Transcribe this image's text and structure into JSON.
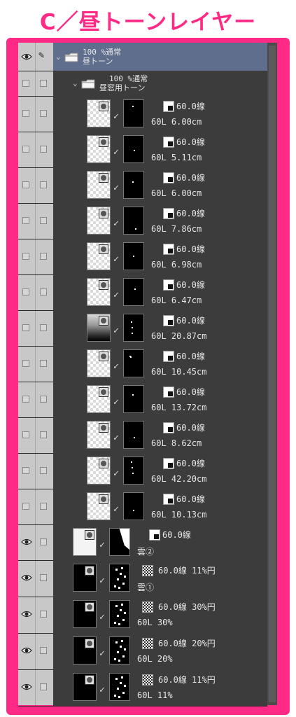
{
  "title": "C／昼トーンレイヤー",
  "groups": [
    {
      "line1": "100 %通常",
      "line2": "昼トーン"
    },
    {
      "line1": "100 %通常",
      "line2": "昼窓用トーン"
    }
  ],
  "tone_layers": [
    {
      "density": "60.0線",
      "name": "60L 6.00cm"
    },
    {
      "density": "60.0線",
      "name": "60L 5.11cm"
    },
    {
      "density": "60.0線",
      "name": "60L 6.00cm"
    },
    {
      "density": "60.0線",
      "name": "60L 7.86cm"
    },
    {
      "density": "60.0線",
      "name": "60L 6.98cm"
    },
    {
      "density": "60.0線",
      "name": "60L 6.47cm"
    },
    {
      "density": "60.0線",
      "name": "60L 20.87cm"
    },
    {
      "density": "60.0線",
      "name": "60L 10.45cm"
    },
    {
      "density": "60.0線",
      "name": "60L 13.72cm"
    },
    {
      "density": "60.0線",
      "name": "60L 8.62cm"
    },
    {
      "density": "60.0線",
      "name": "60L 42.20cm"
    },
    {
      "density": "60.0線",
      "name": "60L 10.13cm"
    }
  ],
  "outer_layers": [
    {
      "density": "60.0線",
      "name": "雲②"
    },
    {
      "density": "60.0線 11%円",
      "name": "雲①"
    },
    {
      "density": "60.0線 30%円",
      "name": "60L 30%"
    },
    {
      "density": "60.0線 20%円",
      "name": "60L 20%"
    },
    {
      "density": "60.0線 11%円",
      "name": "60L 11%"
    }
  ],
  "colors": {
    "accent": "#ff2a86",
    "selected": "#5e6e8c",
    "panel": "#3a3a3a"
  }
}
